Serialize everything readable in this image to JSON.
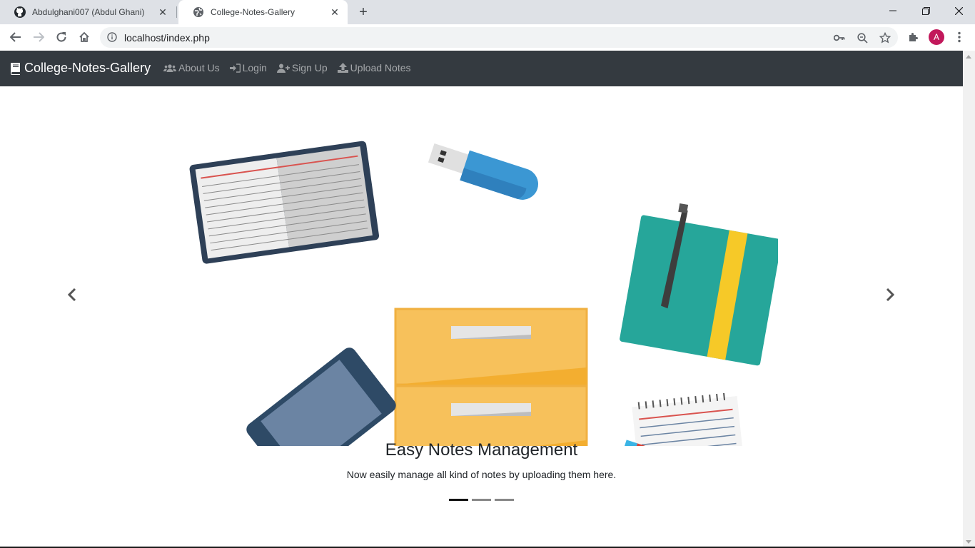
{
  "browser": {
    "tabs": [
      {
        "title": "Abdulghani007 (Abdul Ghani)",
        "icon": "github-icon"
      },
      {
        "title": "College-Notes-Gallery",
        "icon": "globe-icon"
      }
    ],
    "url": "localhost/index.php",
    "profile_initial": "A"
  },
  "navbar": {
    "brand": "College-Notes-Gallery",
    "links": [
      {
        "label": "About Us",
        "icon": "users-icon"
      },
      {
        "label": "Login",
        "icon": "sign-in-icon"
      },
      {
        "label": "Sign Up",
        "icon": "user-plus-icon"
      },
      {
        "label": "Upload Notes",
        "icon": "upload-icon"
      }
    ]
  },
  "carousel": {
    "caption_title": "Easy Notes Management",
    "caption_text": "Now easily manage all kind of notes by uploading them here.",
    "slide_count": 3,
    "active_index": 0
  },
  "colors": {
    "navbar_bg": "#343a40",
    "cabinet": "#f7c15b",
    "notebook": "#26a69a",
    "usb": "#3b97d3",
    "avatar": "#c2185b"
  }
}
